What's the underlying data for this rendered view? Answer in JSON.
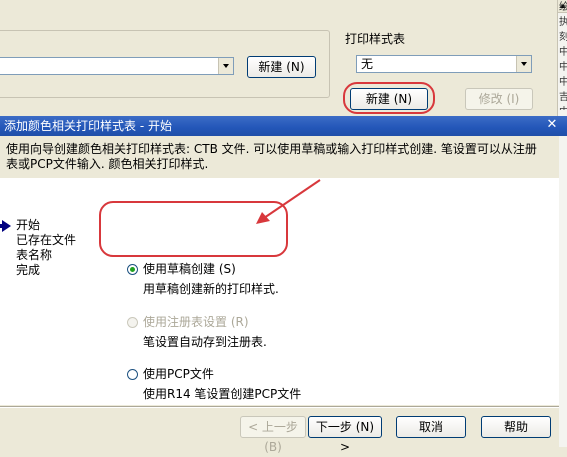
{
  "background_window": {
    "new_button_left": "新建 (N)",
    "plot_style_label": "打印样式表",
    "plot_style_value": "无",
    "new_button_right": "新建 (N)",
    "modify_button": "修改 (I)",
    "side_chars": [
      "绘",
      "执",
      "刻",
      "中",
      "中",
      "中",
      "吉",
      "中"
    ]
  },
  "dialog": {
    "title": "添加颜色相关打印样式表 - 开始",
    "close_glyph": "✕",
    "intro": "使用向导创建颜色相关打印样式表: CTB 文件. 可以使用草稿或输入打印样式创建. 笔设置可以从注册表或PCP文件输入. 颜色相关打印样式.",
    "steps": [
      "开始",
      "已存在文件",
      "表名称",
      "完成"
    ],
    "options": [
      {
        "label": "使用草稿创建 (S)",
        "desc": "用草稿创建新的打印样式.",
        "checked": true,
        "enabled": true
      },
      {
        "label": "使用注册表设置 (R)",
        "desc": "笔设置自动存到注册表.",
        "checked": false,
        "enabled": false
      },
      {
        "label": "使用PCP文件",
        "desc": "使用R14 笔设置创建PCP文件",
        "checked": false,
        "enabled": true
      }
    ],
    "buttons": {
      "back": "< 上一步 (B)",
      "next": "下一步 (N) >",
      "cancel": "取消",
      "help": "帮助"
    }
  },
  "colors": {
    "title_bar": "#2356b8",
    "annotation_red": "#d8383c",
    "dialog_bg": "#ece9d8"
  }
}
